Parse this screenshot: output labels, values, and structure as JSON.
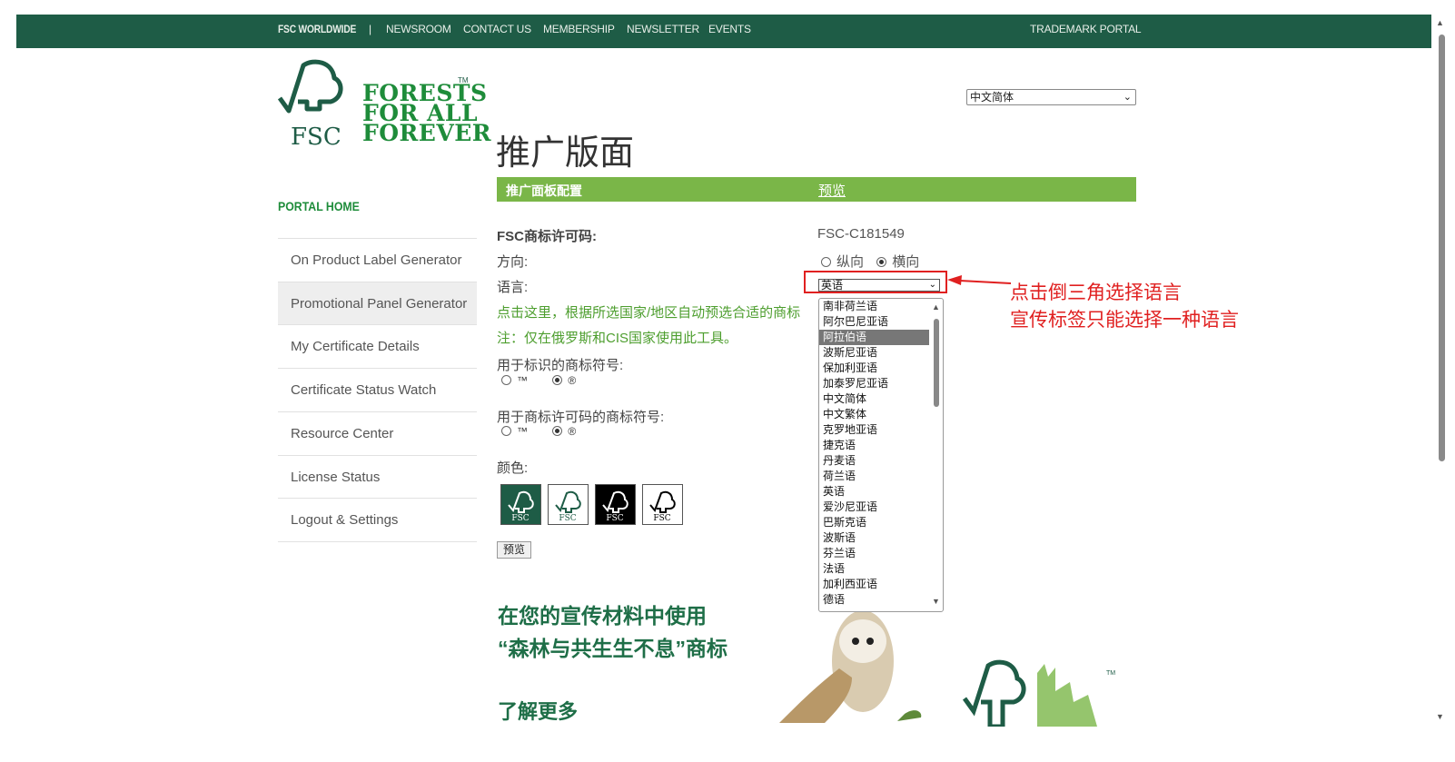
{
  "topbar": {
    "worldwide": "FSC WORLDWIDE",
    "separator": "|",
    "newsroom": "NEWSROOM",
    "contact": "CONTACT US",
    "membership": "MEMBERSHIP",
    "newsletter": "NEWSLETTER",
    "events": "EVENTS",
    "trademark": "TRADEMARK PORTAL"
  },
  "logo": {
    "line1": "FORESTS",
    "line2": "FOR ALL",
    "line3": "FOREVER",
    "fsc": "FSC",
    "tm": "TM"
  },
  "sidebar": {
    "home": "PORTAL HOME",
    "items": [
      {
        "label": "On Product Label Generator"
      },
      {
        "label": "Promotional Panel Generator"
      },
      {
        "label": "My Certificate Details"
      },
      {
        "label": "Certificate Status Watch"
      },
      {
        "label": "Resource Center"
      },
      {
        "label": "License Status"
      },
      {
        "label": "Logout & Settings"
      }
    ]
  },
  "site_language": "中文简体",
  "page_title": "推广版面",
  "config_bar": {
    "label": "推广面板配置",
    "preview_link": "预览"
  },
  "form": {
    "license_label": "FSC商标许可码:",
    "license_value": "FSC-C181549",
    "orientation_label": "方向:",
    "orientation_portrait": "纵向",
    "orientation_landscape": "横向",
    "language_label": "语言:",
    "language_value": "英语",
    "auto_select_link": "点击这里，根据所选国家/地区自动预选合适的商标",
    "note": "注：仅在俄罗斯和CIS国家使用此工具。",
    "mark_symbol_label": "用于标识的商标符号:",
    "license_symbol_label": "用于商标许可码的商标符号:",
    "tm": "™",
    "r": "®",
    "color_label": "颜色:",
    "preview_button": "预览"
  },
  "language_options": [
    "南非荷兰语",
    "阿尔巴尼亚语",
    "阿拉伯语",
    "波斯尼亚语",
    "保加利亚语",
    "加泰罗尼亚语",
    "中文简体",
    "中文繁体",
    "克罗地亚语",
    "捷克语",
    "丹麦语",
    "荷兰语",
    "英语",
    "爱沙尼亚语",
    "巴斯克语",
    "波斯语",
    "芬兰语",
    "法语",
    "加利西亚语",
    "德语"
  ],
  "highlighted_option": "阿拉伯语",
  "annotation": {
    "line1": "点击倒三角选择语言",
    "line2": "宣传标签只能选择一种语言",
    "color": "#e02020"
  },
  "promo": {
    "line1": "在您的宣传材料中使用",
    "line2": "“森林与共生生不息”商标",
    "learn_more": "了解更多"
  },
  "colors": {
    "brand_dark": "#1e5c46",
    "brand_green": "#1e8c3a",
    "bar_green": "#7ab648"
  }
}
